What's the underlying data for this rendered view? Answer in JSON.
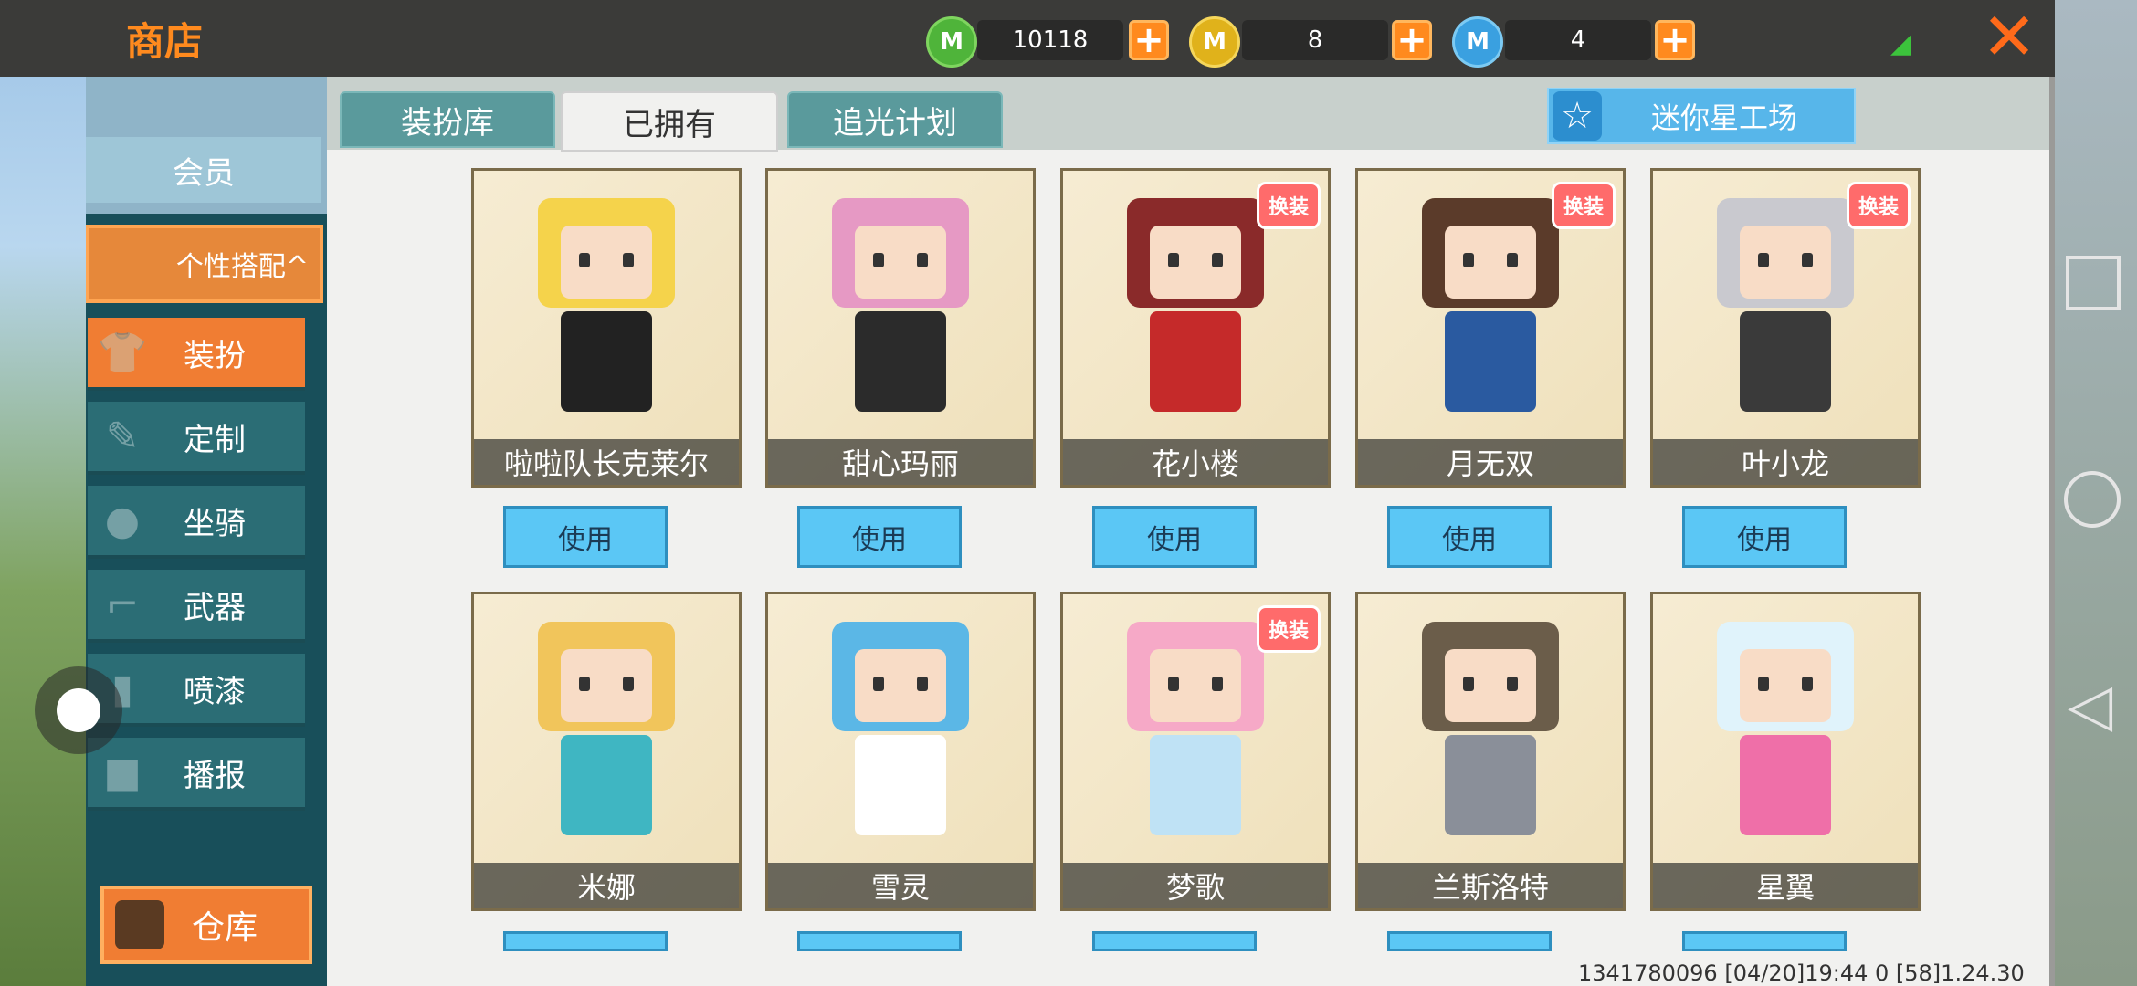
{
  "header": {
    "title": "商店"
  },
  "currencies": [
    {
      "icon": "green-m-coin-icon",
      "value": "10118",
      "color": "#4fb43a"
    },
    {
      "icon": "gold-m-coin-icon",
      "value": "8",
      "color": "#e0b21b"
    },
    {
      "icon": "blue-m-coin-icon",
      "value": "4",
      "color": "#3aa0e0"
    }
  ],
  "tabs": [
    {
      "label": "装扮库"
    },
    {
      "label": "已拥有"
    },
    {
      "label": "追光计划"
    }
  ],
  "studio_label": "迷你星工场",
  "sidebar": {
    "vip": "会员",
    "group": "个性搭配^",
    "items": [
      {
        "label": "装扮",
        "icon": "shirt-icon"
      },
      {
        "label": "定制",
        "icon": "pencil-icon"
      },
      {
        "label": "坐骑",
        "icon": "footprint-icon"
      },
      {
        "label": "武器",
        "icon": "gun-icon"
      },
      {
        "label": "喷漆",
        "icon": "spray-icon"
      },
      {
        "label": "播报",
        "icon": "gift-icon"
      }
    ],
    "warehouse": "仓库"
  },
  "use_label": "使用",
  "badge_label": "换装",
  "cards": [
    {
      "name": "啦啦队长克莱尔",
      "badge": false,
      "hair": "#f5d34b",
      "outfit": "#222"
    },
    {
      "name": "甜心玛丽",
      "badge": false,
      "hair": "#e699c4",
      "outfit": "#2b2b2b"
    },
    {
      "name": "花小楼",
      "badge": true,
      "hair": "#8a2a2a",
      "outfit": "#c52a2a"
    },
    {
      "name": "月无双",
      "badge": true,
      "hair": "#5b3b2a",
      "outfit": "#2a5aa0"
    },
    {
      "name": "叶小龙",
      "badge": true,
      "hair": "#c9c9cf",
      "outfit": "#3a3a3a"
    },
    {
      "name": "米娜",
      "badge": false,
      "hair": "#f1c55b",
      "outfit": "#3fb6c2"
    },
    {
      "name": "雪灵",
      "badge": false,
      "hair": "#5bb7e6",
      "outfit": "#ffffff"
    },
    {
      "name": "梦歌",
      "badge": true,
      "hair": "#f6a9c7",
      "outfit": "#bfe2f5"
    },
    {
      "name": "兰斯洛特",
      "badge": false,
      "hair": "#6b5d4a",
      "outfit": "#8a8f99"
    },
    {
      "name": "星翼",
      "badge": false,
      "hair": "#e0f3fb",
      "outfit": "#ef6fa8"
    }
  ],
  "device_info": "1341780096   [04/20]19:44 0  [58]1.24.30"
}
